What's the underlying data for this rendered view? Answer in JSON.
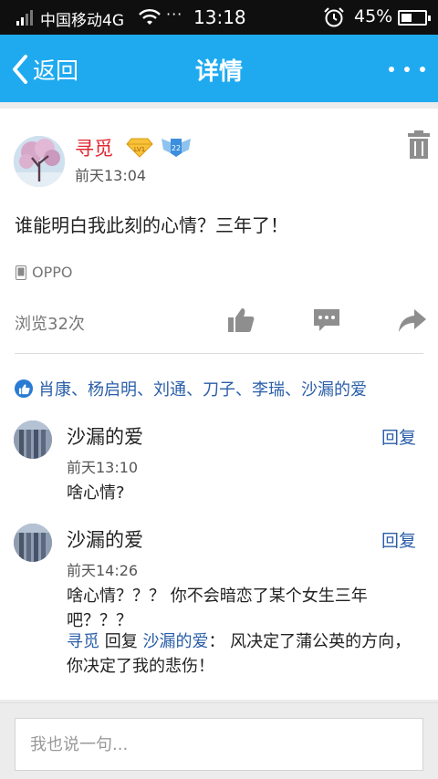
{
  "status_bar": {
    "carrier": "中国移动4G",
    "dots": "···",
    "time": "13:18",
    "battery_percent": "45%",
    "battery_level": 0.45
  },
  "nav": {
    "back_label": "返回",
    "title": "详情"
  },
  "post": {
    "author": "寻觅",
    "time": "前天13:04",
    "content": "谁能明白我此刻的心情？三年了！",
    "device": "OPPO",
    "views": "浏览32次",
    "badge_level_1": "LV1",
    "badge_level_2": "22",
    "likers": "肖康、杨启明、刘通、刀子、李瑞、沙漏的爱"
  },
  "comments": [
    {
      "name": "沙漏的爱",
      "reply_label": "回复",
      "time": "前天13:10",
      "text": "啥心情?"
    },
    {
      "name": "沙漏的爱",
      "reply_label": "回复",
      "time": "前天14:26",
      "text": "啥心情？？？ 你不会暗恋了某个女生三年吧？？？",
      "sub_reply": {
        "from": "寻觅",
        "verb": " 回复 ",
        "to": "沙漏的爱",
        "colon": "：",
        "text": " 风决定了蒲公英的方向，你决定了我的悲伤！"
      }
    }
  ],
  "input": {
    "placeholder": "我也说一句..."
  },
  "colors": {
    "nav_bg": "#1faaf0",
    "author_red": "#e0262f",
    "link_blue": "#2a5ea8"
  }
}
